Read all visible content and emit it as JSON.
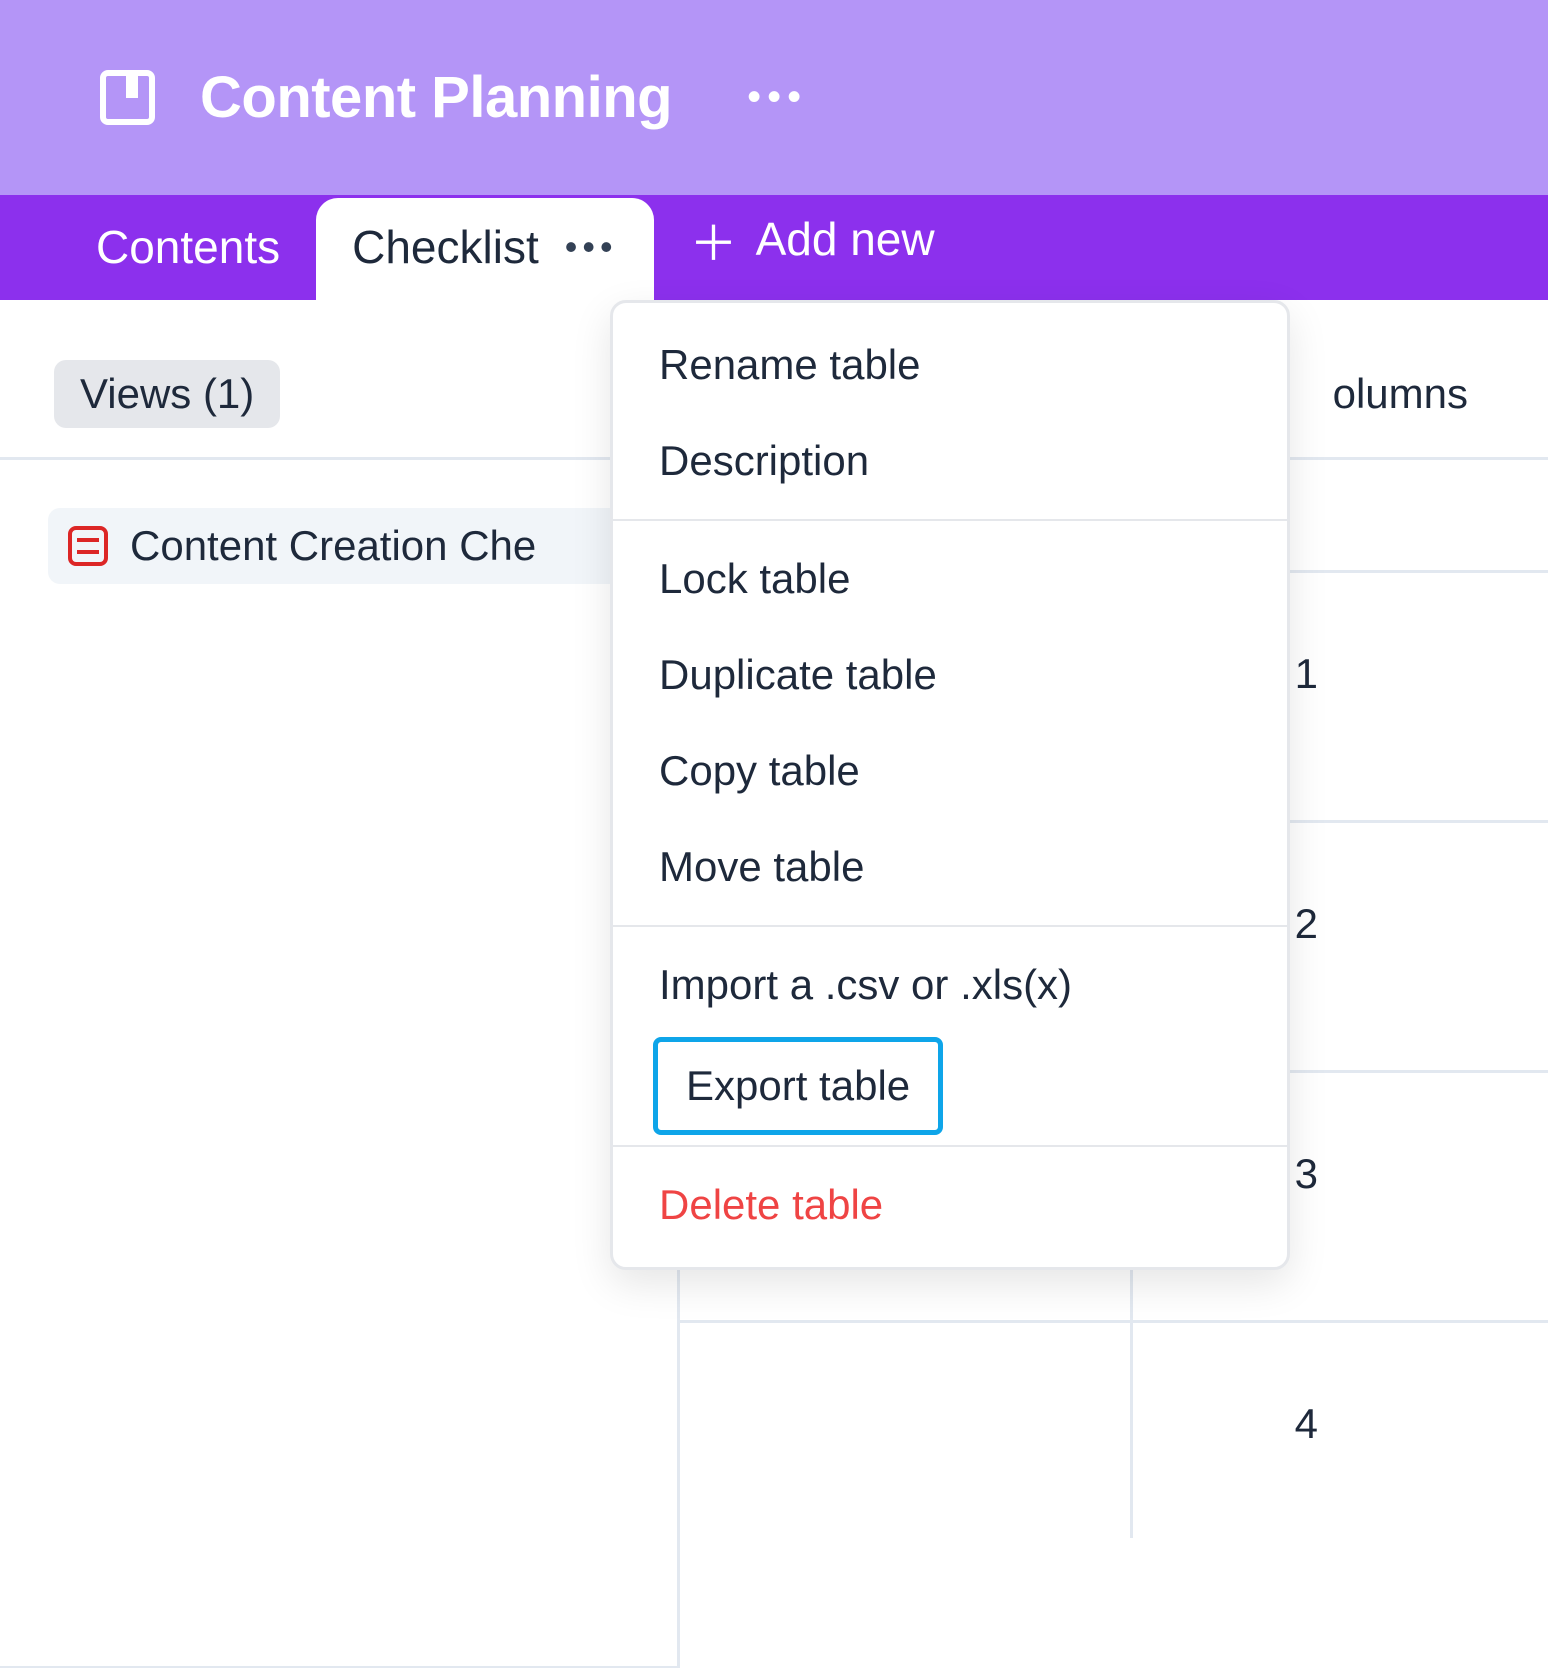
{
  "header": {
    "title": "Content Planning"
  },
  "tabs": {
    "items": [
      {
        "label": "Contents"
      },
      {
        "label": "Checklist"
      }
    ],
    "add_label": "Add new"
  },
  "toolbar": {
    "views_label": "Views (1)",
    "columns_label": "olumns"
  },
  "views": {
    "items": [
      {
        "label": "Content Creation Che"
      }
    ]
  },
  "table": {
    "row_numbers": [
      "1",
      "2",
      "3",
      "4"
    ]
  },
  "menu": {
    "rename": "Rename table",
    "description": "Description",
    "lock": "Lock table",
    "duplicate": "Duplicate table",
    "copy": "Copy table",
    "move": "Move table",
    "import": "Import a .csv or .xls(x)",
    "export": "Export table",
    "delete": "Delete table"
  }
}
